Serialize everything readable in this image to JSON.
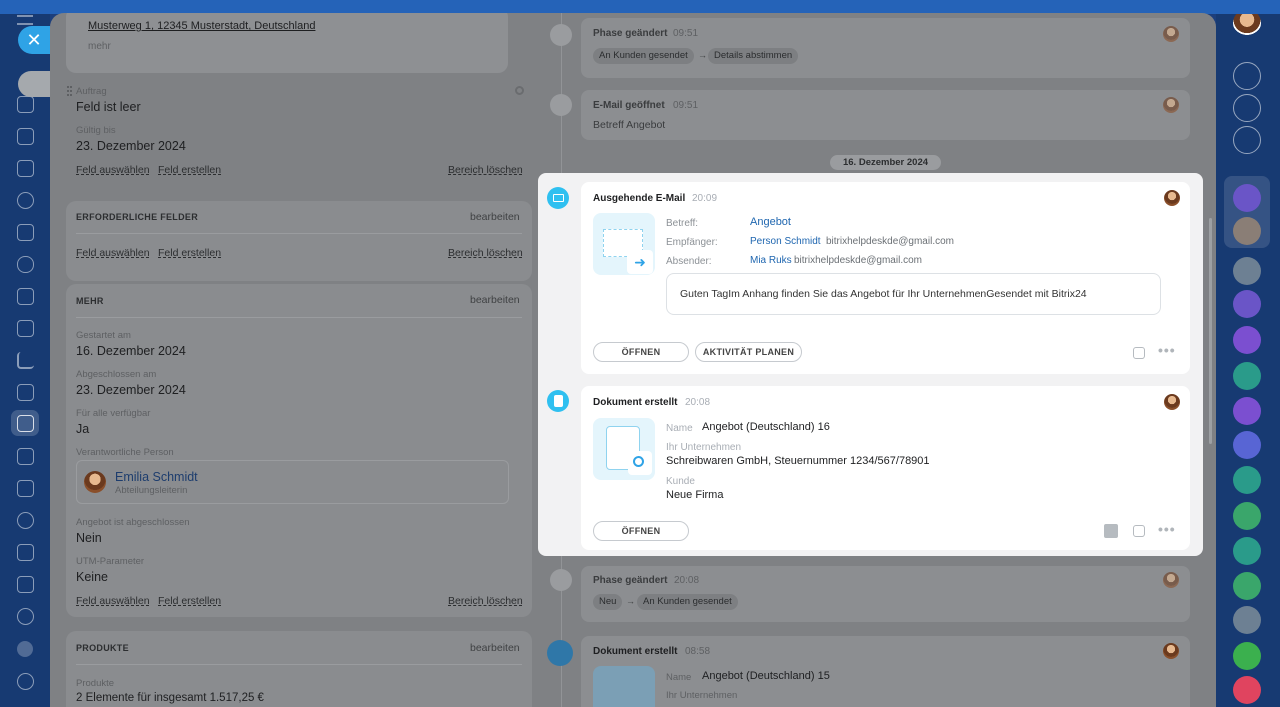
{
  "left_panel": {
    "address": "Musterweg 1, 12345 Musterstadt, Deutschland",
    "more_link": "mehr",
    "order_label": "Auftrag",
    "order_value": "Feld ist leer",
    "valid_until_label": "Gültig bis",
    "valid_until_value": "23. Dezember 2024",
    "select_field": "Feld auswählen",
    "create_field": "Feld erstellen",
    "clear_section": "Bereich löschen",
    "required_section_title": "ERFORDERLICHE FELDER",
    "edit_label": "bearbeiten",
    "more_section_title": "MEHR",
    "started_label": "Gestartet am",
    "started_value": "16. Dezember 2024",
    "completed_label": "Abgeschlossen am",
    "completed_value": "23. Dezember 2024",
    "available_label": "Für alle verfügbar",
    "available_value": "Ja",
    "responsible_label": "Verantwortliche Person",
    "responsible_name": "Emilia Schmidt",
    "responsible_role": "Abteilungsleiterin",
    "offer_closed_label": "Angebot ist abgeschlossen",
    "offer_closed_value": "Nein",
    "utm_label": "UTM-Parameter",
    "utm_value": "Keine",
    "products_section_title": "PRODUKTE",
    "products_label": "Produkte",
    "products_value": "2 Elemente für insgesamt 1.517,25 €"
  },
  "timeline": {
    "phase1": {
      "title": "Phase geändert",
      "time": "09:51",
      "from": "An Kunden gesendet",
      "arrow": "→",
      "to": "Details abstimmen"
    },
    "mail_opened": {
      "title": "E-Mail geöffnet",
      "time": "09:51",
      "text": "Betreff Angebot"
    },
    "date_separator": "16. Dezember 2024",
    "email": {
      "title": "Ausgehende E-Mail",
      "time": "20:09",
      "subject_label": "Betreff:",
      "subject_value": "Angebot",
      "recipient_label": "Empfänger:",
      "recipient_name": "Person Schmidt",
      "recipient_email": "bitrixhelpdeskde@gmail.com",
      "sender_label": "Absender:",
      "sender_name": "Mia Ruks",
      "sender_email": "bitrixhelpdeskde@gmail.com",
      "body": "Guten TagIm Anhang finden Sie das Angebot für Ihr UnternehmenGesendet mit Bitrix24",
      "open_button": "ÖFFNEN",
      "plan_button": "AKTIVITÄT PLANEN"
    },
    "doc1": {
      "title": "Dokument erstellt",
      "time": "20:08",
      "name_label": "Name",
      "name_value": "Angebot (Deutschland) 16",
      "company_label": "Ihr Unternehmen",
      "company_value": "Schreibwaren GmbH, Steuernummer 1234/567/78901",
      "client_label": "Kunde",
      "client_value": "Neue Firma",
      "open_button": "ÖFFNEN"
    },
    "phase2": {
      "title": "Phase geändert",
      "time": "20:08",
      "from": "Neu",
      "arrow": "→",
      "to": "An Kunden gesendet"
    },
    "doc2": {
      "title": "Dokument erstellt",
      "time": "08:58",
      "name_label": "Name",
      "name_value": "Angebot (Deutschland) 15",
      "company_label": "Ihr Unternehmen"
    }
  },
  "colors": {
    "accent": "#2fa3e6",
    "link": "#2067b0",
    "muted": "#a8adb4"
  }
}
